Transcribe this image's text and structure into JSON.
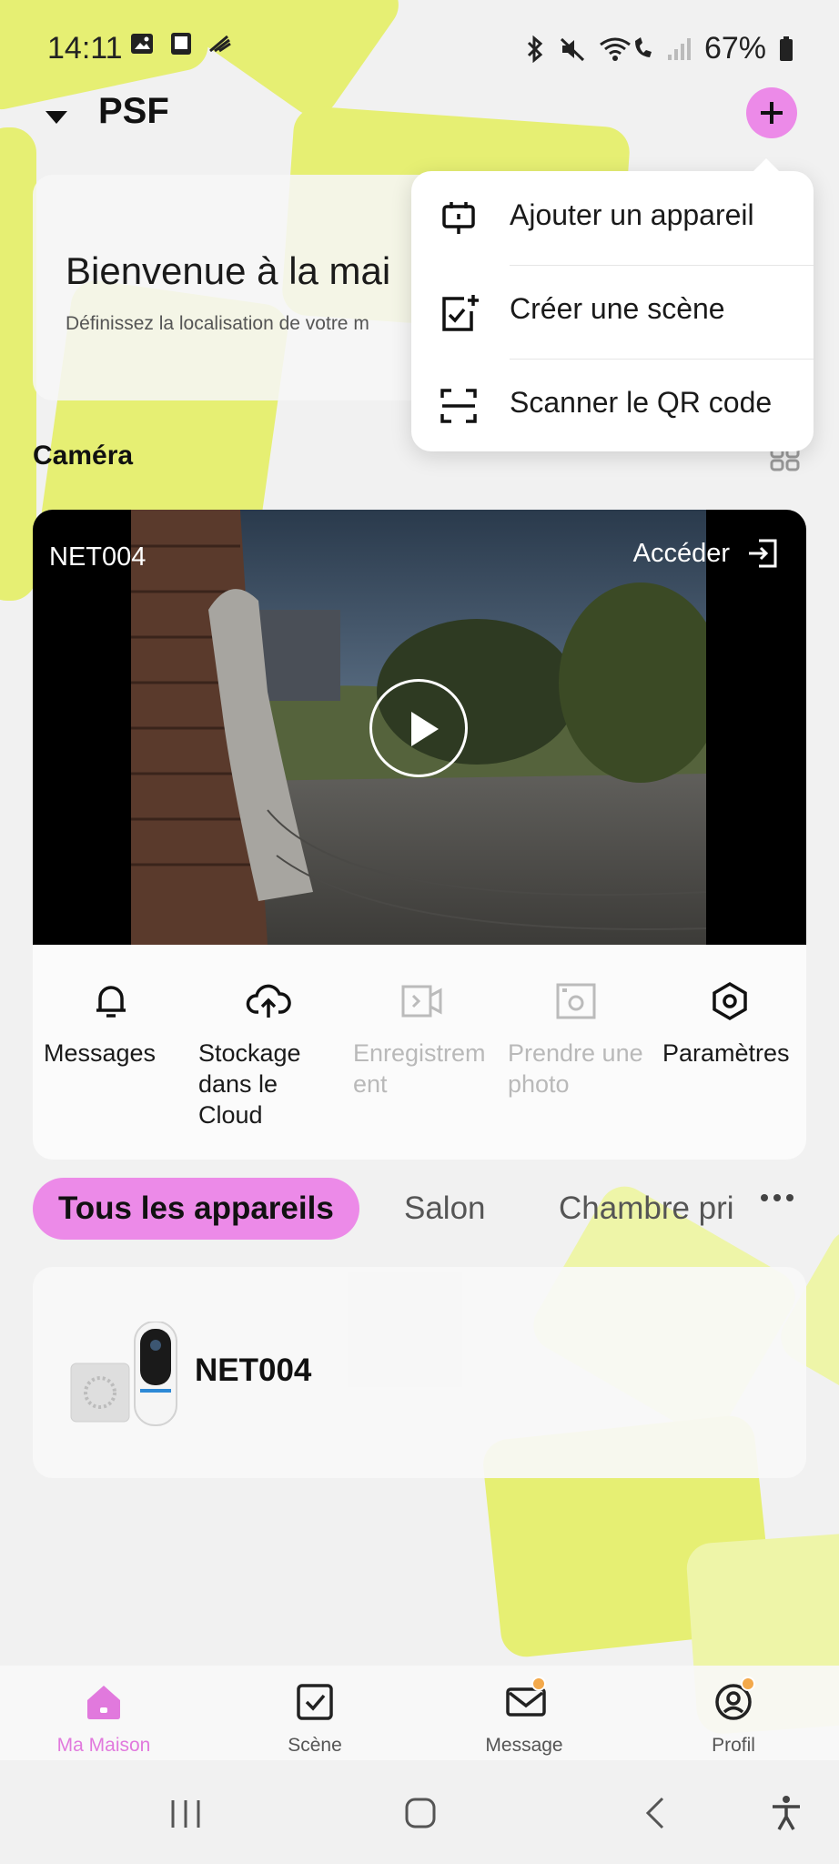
{
  "status_bar": {
    "time": "14:11",
    "battery": "67%"
  },
  "header": {
    "home_name": "PSF"
  },
  "menu": {
    "items": [
      {
        "label": "Ajouter un appareil",
        "icon": "add-device-icon"
      },
      {
        "label": "Créer une scène",
        "icon": "create-scene-icon"
      },
      {
        "label": "Scanner le QR code",
        "icon": "scan-qr-icon"
      }
    ]
  },
  "welcome": {
    "title": "Bienvenue à la mai",
    "subtitle": "Définissez la localisation de votre m"
  },
  "section": {
    "title": "Caméra"
  },
  "camera": {
    "name": "NET004",
    "open_label": "Accéder",
    "actions": [
      {
        "label": "Messages",
        "icon": "bell-icon",
        "enabled": true
      },
      {
        "label": "Stockage dans le Cloud",
        "icon": "cloud-upload-icon",
        "enabled": true
      },
      {
        "label": "Enregistrem ent",
        "icon": "record-video-icon",
        "enabled": false
      },
      {
        "label": "Prendre une photo",
        "icon": "camera-snapshot-icon",
        "enabled": false
      },
      {
        "label": "Paramètres",
        "icon": "settings-hexagon-icon",
        "enabled": true
      }
    ]
  },
  "tabs": {
    "items": [
      "Tous les appareils",
      "Salon",
      "Chambre pri"
    ]
  },
  "device": {
    "name": "NET004"
  },
  "bottom_nav": {
    "items": [
      {
        "label": "Ma Maison",
        "icon": "home-icon",
        "active": true
      },
      {
        "label": "Scène",
        "icon": "scene-checkbox-icon",
        "active": false
      },
      {
        "label": "Message",
        "icon": "message-envelope-icon",
        "active": false
      },
      {
        "label": "Profil",
        "icon": "profile-icon",
        "active": false
      }
    ]
  },
  "colors": {
    "accent": "#ec8ae8",
    "background_shape": "#e6ef73",
    "active_nav_text": "#e179dd"
  }
}
